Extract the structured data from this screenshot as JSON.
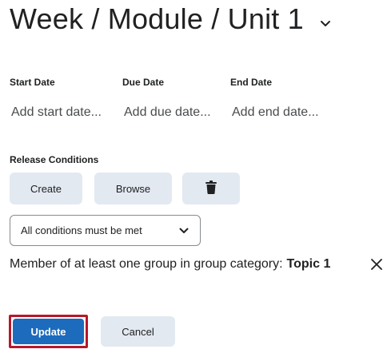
{
  "header": {
    "title": "Week / Module / Unit 1"
  },
  "dates": {
    "start": {
      "label": "Start Date",
      "placeholder": "Add start date..."
    },
    "due": {
      "label": "Due Date",
      "placeholder": "Add due date..."
    },
    "end": {
      "label": "End Date",
      "placeholder": "Add end date..."
    }
  },
  "release_conditions": {
    "label": "Release Conditions",
    "create_label": "Create",
    "browse_label": "Browse",
    "match_select": {
      "selected": "All conditions must be met"
    },
    "conditions": [
      {
        "text": "Member of at least one group in group category:",
        "value": "Topic 1"
      }
    ]
  },
  "actions": {
    "update_label": "Update",
    "cancel_label": "Cancel"
  },
  "colors": {
    "primary": "#1c6bbd",
    "button_bg": "#e3e9f1",
    "highlight_border": "#b5182a"
  }
}
